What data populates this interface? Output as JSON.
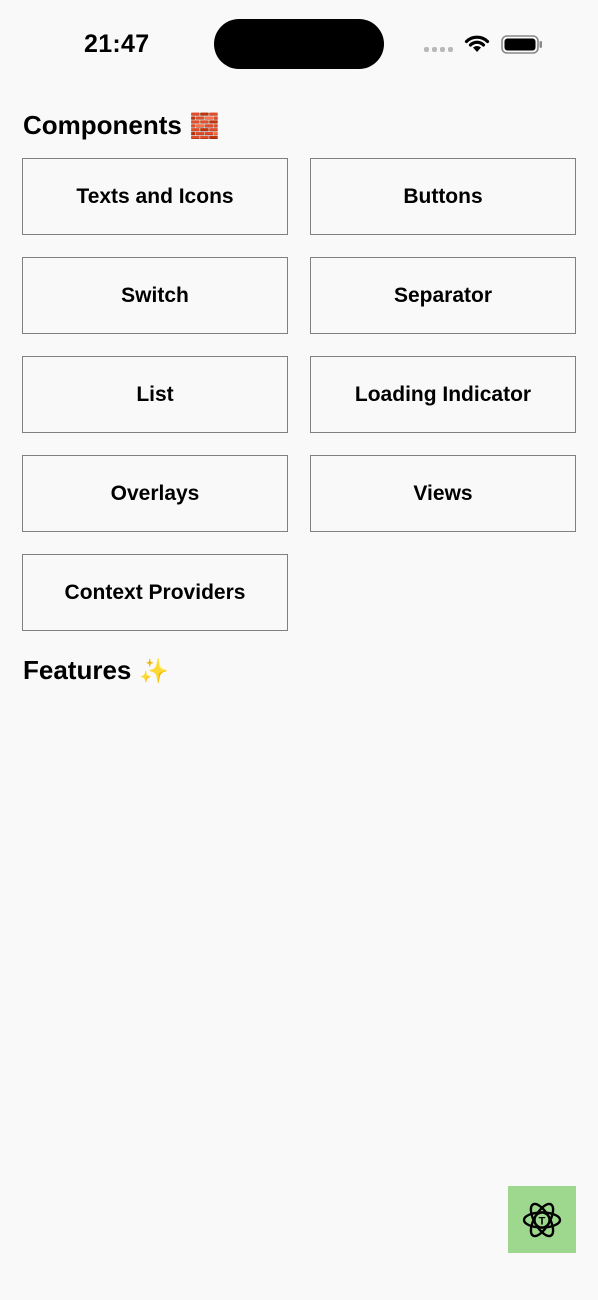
{
  "status_bar": {
    "time": "21:47"
  },
  "sections": {
    "components": {
      "title": "Components",
      "emoji": "🧱",
      "items": [
        "Texts and Icons",
        "Buttons",
        "Switch",
        "Separator",
        "List",
        "Loading Indicator",
        "Overlays",
        "Views",
        "Context Providers"
      ]
    },
    "features": {
      "title": "Features",
      "emoji": "✨"
    }
  },
  "fab": {
    "icon": "atom-icon",
    "color": "#9ed88e"
  },
  "colors": {
    "background": "#f9f9f9",
    "tile_border": "#808080"
  }
}
